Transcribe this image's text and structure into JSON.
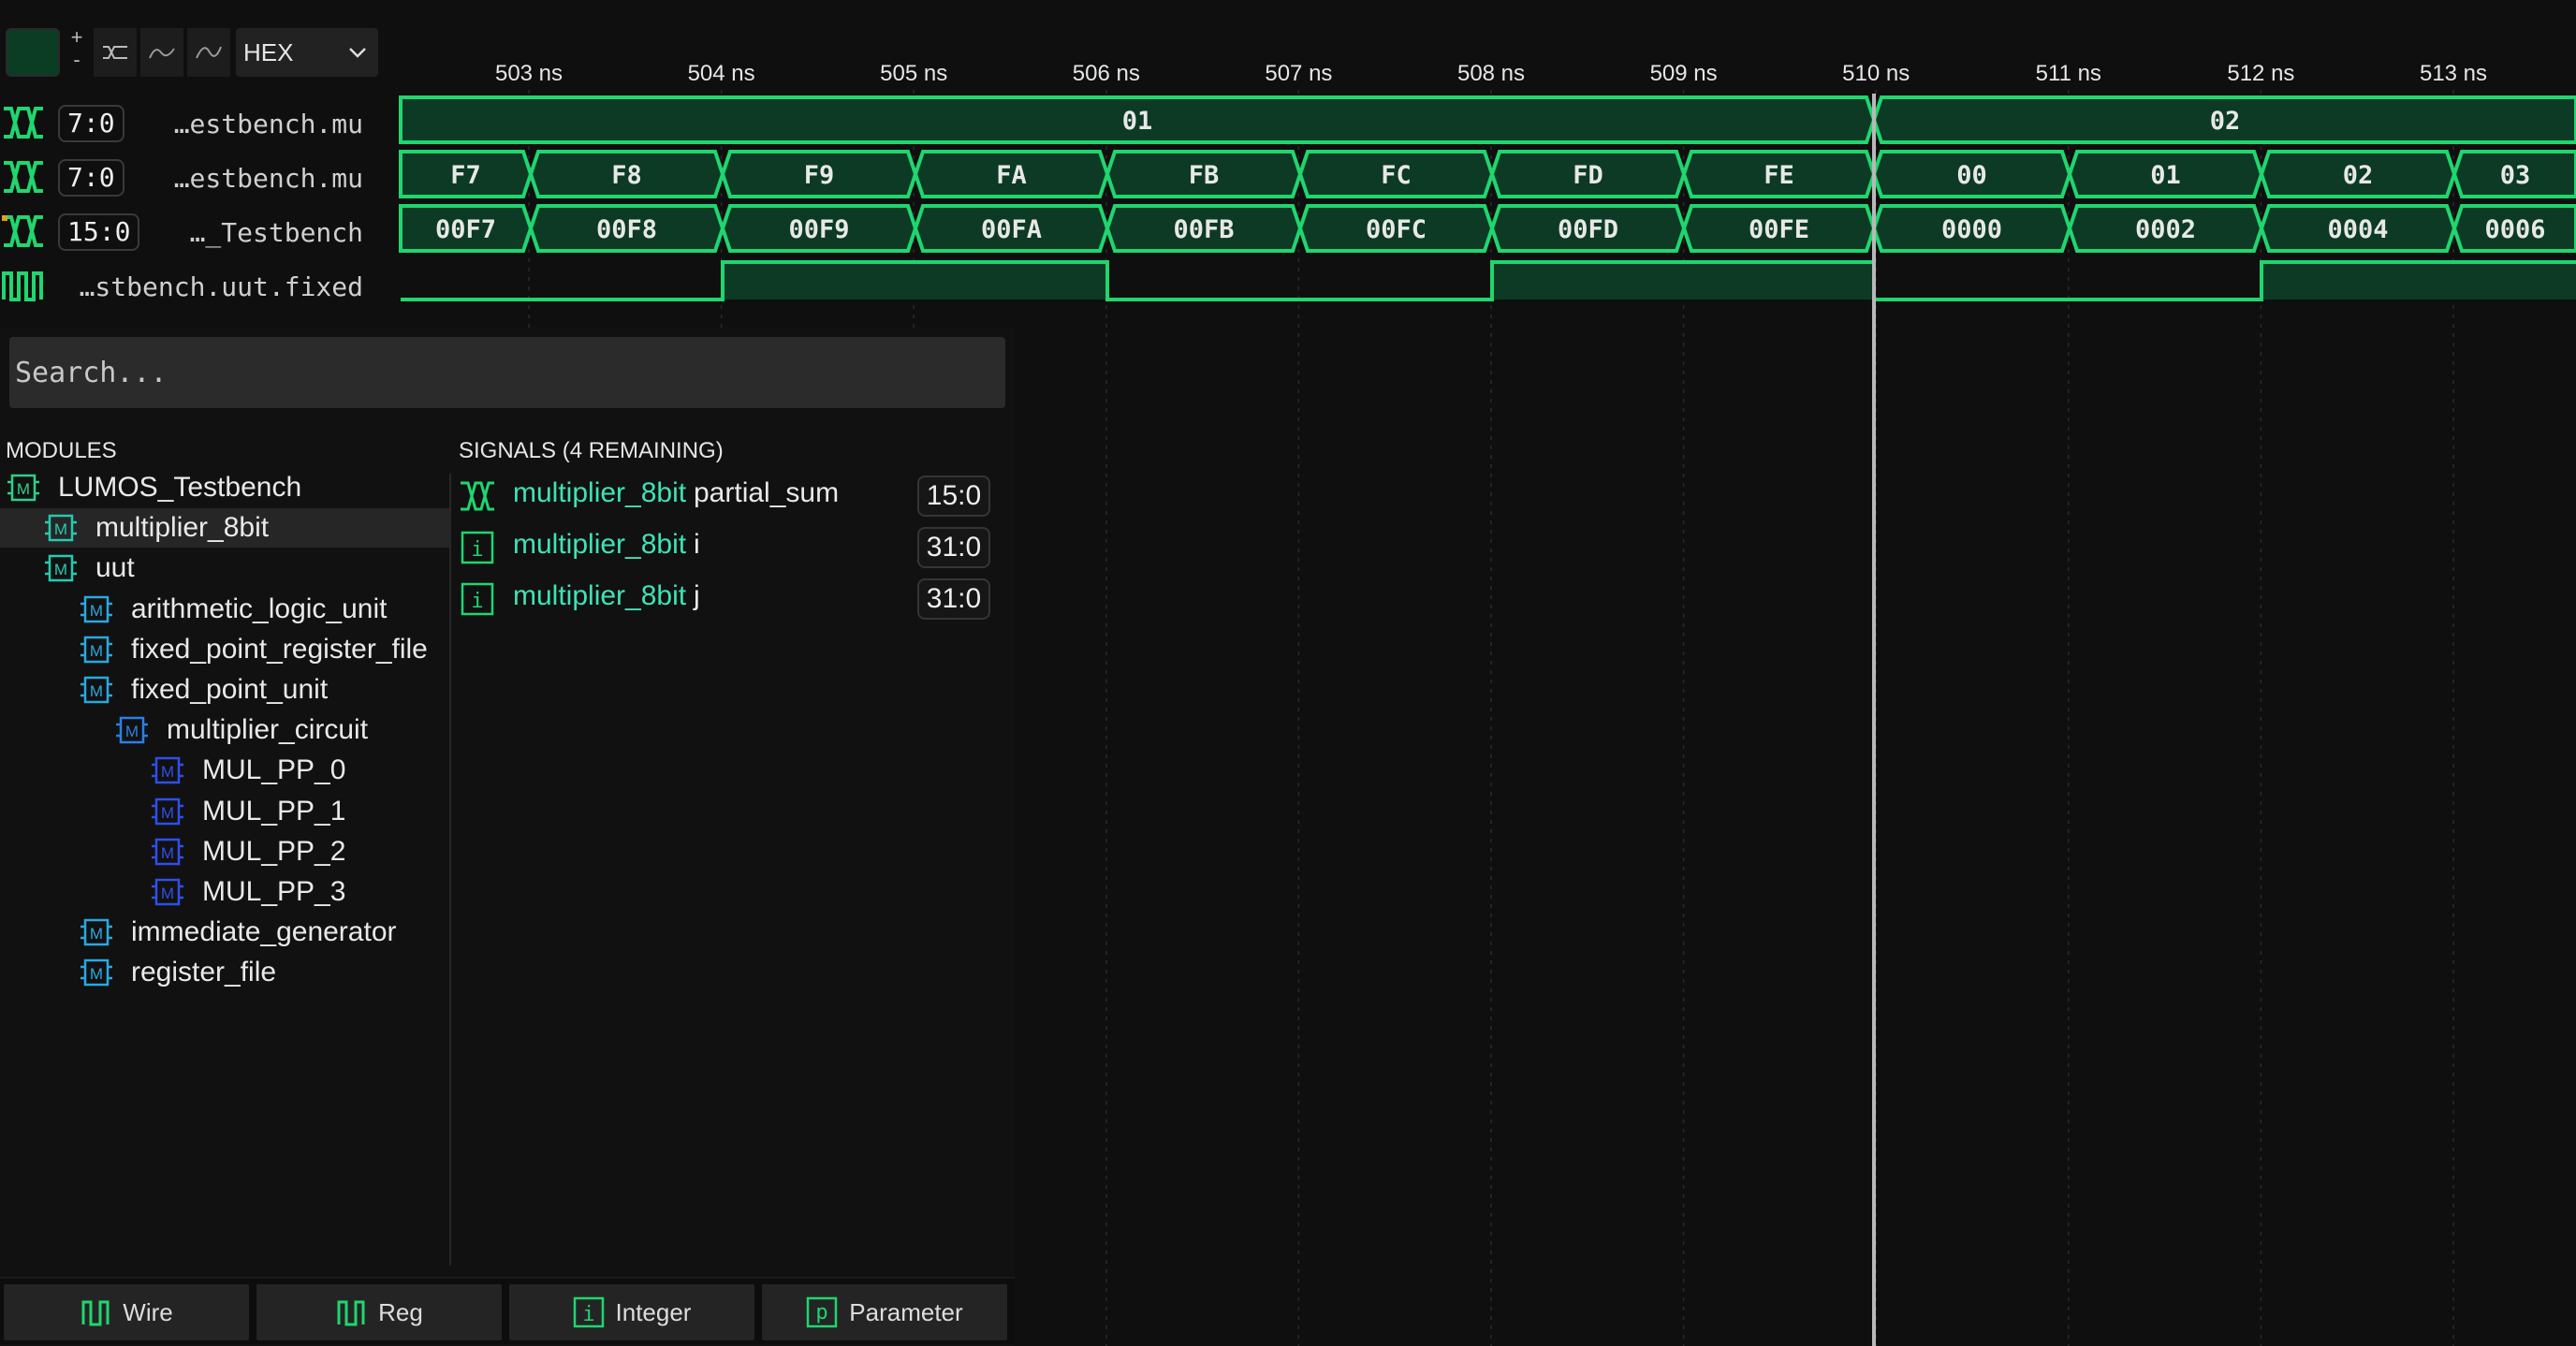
{
  "toolbar": {
    "radix": "HEX",
    "plus": "+",
    "minus": "-"
  },
  "timeline": {
    "ticks": [
      "503 ns",
      "504 ns",
      "505 ns",
      "506 ns",
      "507 ns",
      "508 ns",
      "509 ns",
      "510 ns",
      "511 ns",
      "512 ns",
      "513 ns"
    ]
  },
  "signals_view": [
    {
      "range": "7:0",
      "name": "…estbench.mu",
      "values": [
        "01",
        "02"
      ]
    },
    {
      "range": "7:0",
      "name": "…estbench.mu",
      "values": [
        "F7",
        "F8",
        "F9",
        "FA",
        "FB",
        "FC",
        "FD",
        "FE",
        "00",
        "01",
        "02",
        "03"
      ]
    },
    {
      "range": "15:0",
      "name": "…_Testbench",
      "values": [
        "00F7",
        "00F8",
        "00F9",
        "00FA",
        "00FB",
        "00FC",
        "00FD",
        "00FE",
        "0000",
        "0002",
        "0004",
        "0006"
      ]
    },
    {
      "name": "…stbench.uut.fixed"
    }
  ],
  "search": {
    "placeholder": "Search..."
  },
  "modules": {
    "header": "MODULES",
    "items": [
      {
        "label": "LUMOS_Testbench",
        "color": "#2fd08a"
      },
      {
        "label": "multiplier_8bit",
        "color": "#27c9b0"
      },
      {
        "label": "uut",
        "color": "#27c9b0"
      },
      {
        "label": "arithmetic_logic_unit",
        "color": "#2aa8e0"
      },
      {
        "label": "fixed_point_register_file",
        "color": "#2aa8e0"
      },
      {
        "label": "fixed_point_unit",
        "color": "#2aa8e0"
      },
      {
        "label": "multiplier_circuit",
        "color": "#2a7fe8"
      },
      {
        "label": "MUL_PP_0",
        "color": "#2f4fe8"
      },
      {
        "label": "MUL_PP_1",
        "color": "#2f4fe8"
      },
      {
        "label": "MUL_PP_2",
        "color": "#2f4fe8"
      },
      {
        "label": "MUL_PP_3",
        "color": "#2f4fe8"
      },
      {
        "label": "immediate_generator",
        "color": "#2aa8e0"
      },
      {
        "label": "register_file",
        "color": "#2aa8e0"
      }
    ]
  },
  "signals": {
    "header": "SIGNALS (4 REMAINING)",
    "items": [
      {
        "scope": "multiplier_8bit",
        "name": "partial_sum",
        "range": "15:0",
        "kind": "bus"
      },
      {
        "scope": "multiplier_8bit",
        "name": "i",
        "range": "31:0",
        "kind": "integer"
      },
      {
        "scope": "multiplier_8bit",
        "name": "j",
        "range": "31:0",
        "kind": "integer"
      }
    ]
  },
  "filters": [
    {
      "label": "Wire",
      "icon": "wire-icon"
    },
    {
      "label": "Reg",
      "icon": "reg-icon"
    },
    {
      "label": "Integer",
      "icon": "integer-icon"
    },
    {
      "label": "Parameter",
      "icon": "parameter-icon"
    }
  ],
  "colors": {
    "wave": "#1fd66f",
    "wave_fill": "#0c3a24",
    "accent": "#3fe3b5"
  }
}
